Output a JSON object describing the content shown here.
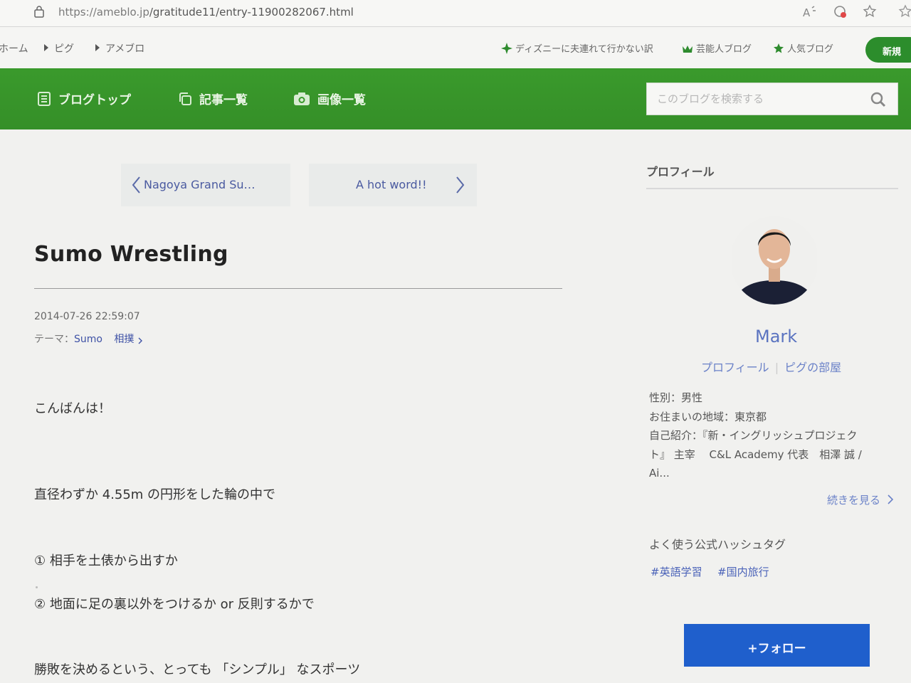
{
  "browser": {
    "url_host": "https://ameblo.jp",
    "url_path": "/gratitude11/entry-11900282067.html"
  },
  "topnav": {
    "breadcrumbs": [
      "ホーム",
      "ピグ",
      "アメブロ"
    ],
    "links": [
      "ディズニーに夫連れて行かない訳",
      "芸能人ブログ",
      "人気ブログ"
    ],
    "new_button": "新規"
  },
  "blognav": {
    "items": [
      "ブログトップ",
      "記事一覧",
      "画像一覧"
    ],
    "search_placeholder": "このブログを検索する"
  },
  "article": {
    "prev_label": "Nagoya Grand Su…",
    "next_label": "A hot word!!",
    "title": "Sumo Wrestling",
    "datetime": "2014-07-26 22:59:07",
    "theme_prefix": "テーマ：",
    "theme_name": "Sumo",
    "theme_tag": "相撲",
    "paragraphs": [
      "こんばんは！",
      "直径わずか 4.55m の円形をした輪の中で",
      "① 相手を土俵から出すか",
      "② 地面に足の裏以外をつけるか or 反則するかで",
      "勝敗を決めるという、とっても 「シンプル」 なスポーツ"
    ]
  },
  "sidebar": {
    "profile_heading": "プロフィール",
    "name": "Mark",
    "profile_link": "プロフィール",
    "pig_link": "ピグの部屋",
    "info_lines": [
      "性別：男性",
      "お住まいの地域：東京都",
      "自己紹介：『新・イングリッシュプロジェク",
      "ト』 主宰　 C&L Academy 代表　相澤 誠 /",
      "Ai..."
    ],
    "more_label": "続きを見る",
    "hashtag_heading": "よく使う公式ハッシュタグ",
    "hashtags": [
      "#英語学習",
      "#国内旅行"
    ],
    "follow_label": "+フォロー"
  },
  "colors": {
    "brand_green": "#3a9a2c",
    "link_blue": "#4a62b8",
    "follow_blue": "#1f5fcc"
  }
}
